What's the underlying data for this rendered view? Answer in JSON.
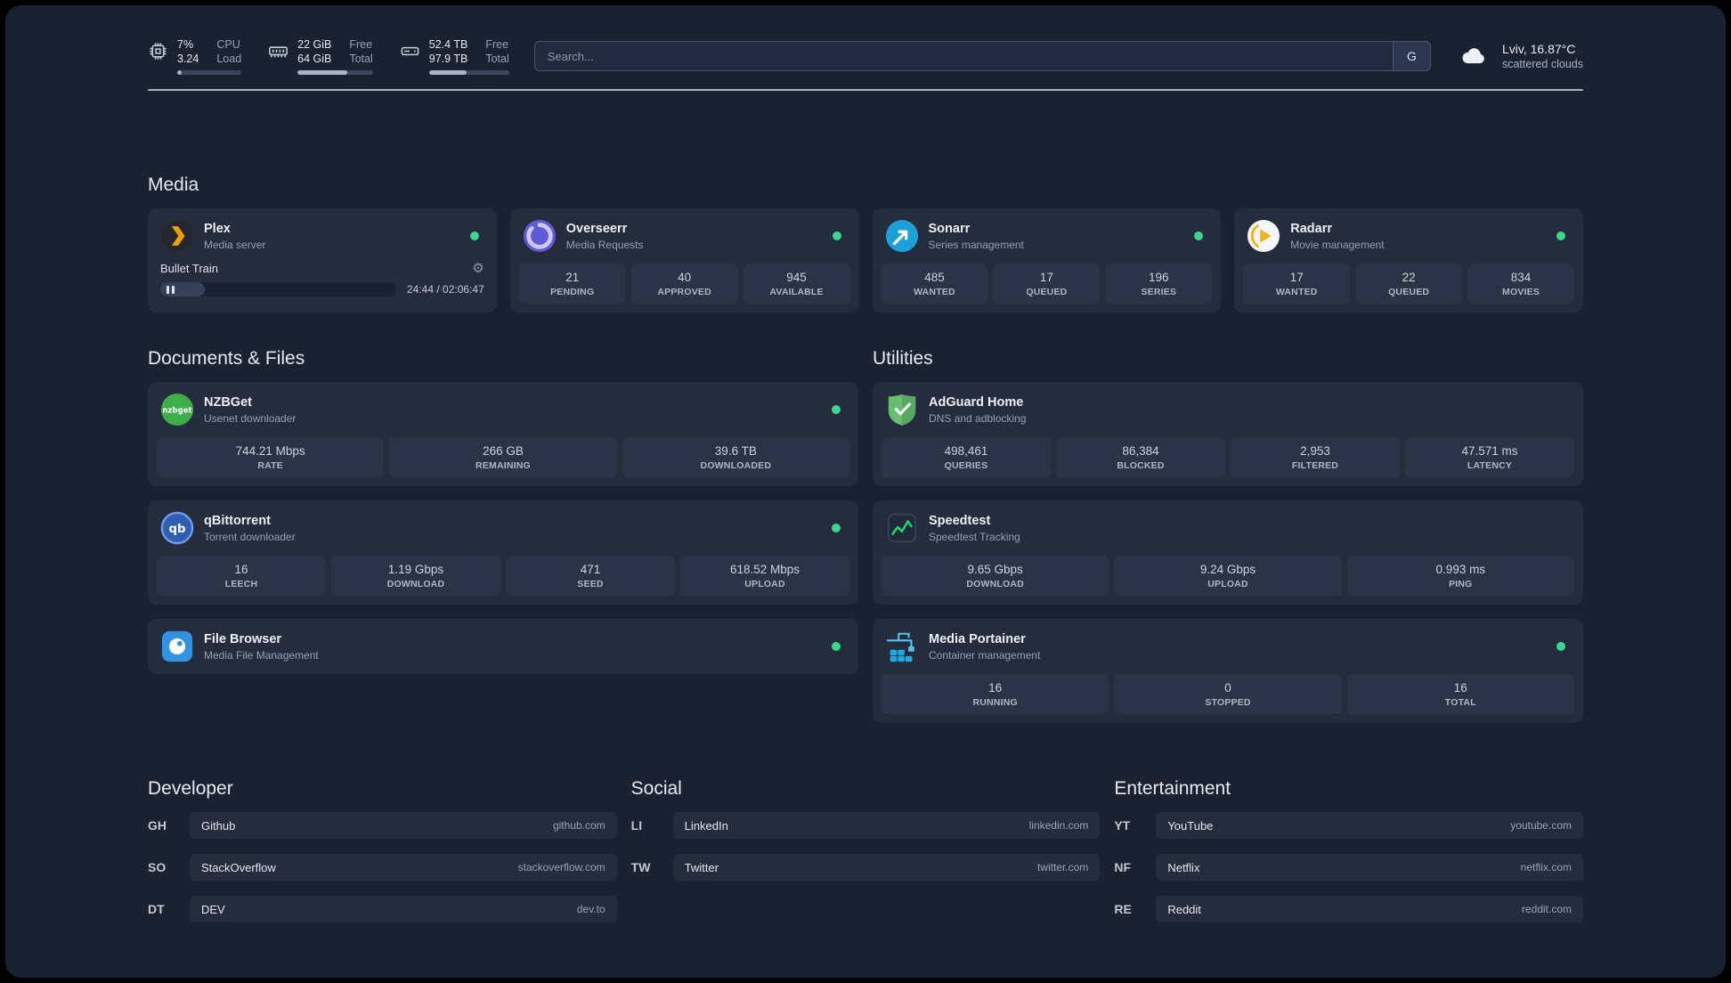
{
  "topbar": {
    "resources": [
      {
        "icon": "cpu-icon",
        "values": [
          "7%",
          "3.24"
        ],
        "labels": [
          "CPU",
          "Load"
        ],
        "progress": 7
      },
      {
        "icon": "memory-icon",
        "values": [
          "22 GiB",
          "64 GiB"
        ],
        "labels": [
          "Free",
          "Total"
        ],
        "progress": 66
      },
      {
        "icon": "disk-icon",
        "values": [
          "52.4 TB",
          "97.9 TB"
        ],
        "labels": [
          "Free",
          "Total"
        ],
        "progress": 47
      }
    ],
    "search": {
      "placeholder": "Search...",
      "provider": "G"
    },
    "weather": {
      "icon": "cloud-icon",
      "location": "Lviv, 16.87°C",
      "condition": "scattered clouds"
    }
  },
  "media": {
    "title": "Media",
    "plex": {
      "title": "Plex",
      "subtitle": "Media server",
      "online": true,
      "now_playing": "Bullet Train",
      "time": "24:44 / 02:06:47",
      "progress": 19
    },
    "cards": [
      {
        "title": "Overseerr",
        "subtitle": "Media Requests",
        "online": true,
        "stats": [
          {
            "value": "21",
            "label": "PENDING"
          },
          {
            "value": "40",
            "label": "APPROVED"
          },
          {
            "value": "945",
            "label": "AVAILABLE"
          }
        ]
      },
      {
        "title": "Sonarr",
        "subtitle": "Series management",
        "online": true,
        "stats": [
          {
            "value": "485",
            "label": "WANTED"
          },
          {
            "value": "17",
            "label": "QUEUED"
          },
          {
            "value": "196",
            "label": "SERIES"
          }
        ]
      },
      {
        "title": "Radarr",
        "subtitle": "Movie management",
        "online": true,
        "stats": [
          {
            "value": "17",
            "label": "WANTED"
          },
          {
            "value": "22",
            "label": "QUEUED"
          },
          {
            "value": "834",
            "label": "MOVIES"
          }
        ]
      }
    ]
  },
  "documents": {
    "title": "Documents & Files",
    "cards": [
      {
        "title": "NZBGet",
        "subtitle": "Usenet downloader",
        "online": true,
        "stats": [
          {
            "value": "744.21 Mbps",
            "label": "RATE"
          },
          {
            "value": "266 GB",
            "label": "REMAINING"
          },
          {
            "value": "39.6 TB",
            "label": "DOWNLOADED"
          }
        ]
      },
      {
        "title": "qBittorrent",
        "subtitle": "Torrent downloader",
        "online": true,
        "stats": [
          {
            "value": "16",
            "label": "LEECH"
          },
          {
            "value": "1.19 Gbps",
            "label": "DOWNLOAD"
          },
          {
            "value": "471",
            "label": "SEED"
          },
          {
            "value": "618.52 Mbps",
            "label": "UPLOAD"
          }
        ]
      },
      {
        "title": "File Browser",
        "subtitle": "Media File Management",
        "online": true,
        "stats": []
      }
    ]
  },
  "utilities": {
    "title": "Utilities",
    "cards": [
      {
        "title": "AdGuard Home",
        "subtitle": "DNS and adblocking",
        "online": false,
        "stats": [
          {
            "value": "498,461",
            "label": "QUERIES"
          },
          {
            "value": "86,384",
            "label": "BLOCKED"
          },
          {
            "value": "2,953",
            "label": "FILTERED"
          },
          {
            "value": "47.571 ms",
            "label": "LATENCY"
          }
        ]
      },
      {
        "title": "Speedtest",
        "subtitle": "Speedtest Tracking",
        "online": false,
        "stats": [
          {
            "value": "9.65 Gbps",
            "label": "DOWNLOAD"
          },
          {
            "value": "9.24 Gbps",
            "label": "UPLOAD"
          },
          {
            "value": "0.993 ms",
            "label": "PING"
          }
        ]
      },
      {
        "title": "Media Portainer",
        "subtitle": "Container management",
        "online": true,
        "stats": [
          {
            "value": "16",
            "label": "RUNNING"
          },
          {
            "value": "0",
            "label": "STOPPED"
          },
          {
            "value": "16",
            "label": "TOTAL"
          }
        ]
      }
    ]
  },
  "bookmarks": [
    {
      "title": "Developer",
      "items": [
        {
          "abbr": "GH",
          "name": "Github",
          "domain": "github.com"
        },
        {
          "abbr": "SO",
          "name": "StackOverflow",
          "domain": "stackoverflow.com"
        },
        {
          "abbr": "DT",
          "name": "DEV",
          "domain": "dev.to"
        }
      ]
    },
    {
      "title": "Social",
      "items": [
        {
          "abbr": "LI",
          "name": "LinkedIn",
          "domain": "linkedin.com"
        },
        {
          "abbr": "TW",
          "name": "Twitter",
          "domain": "twitter.com"
        }
      ]
    },
    {
      "title": "Entertainment",
      "items": [
        {
          "abbr": "YT",
          "name": "YouTube",
          "domain": "youtube.com"
        },
        {
          "abbr": "NF",
          "name": "Netflix",
          "domain": "netflix.com"
        },
        {
          "abbr": "RE",
          "name": "Reddit",
          "domain": "reddit.com"
        }
      ]
    }
  ],
  "icons": {
    "cpu": "cpu-chip",
    "memory": "memory-stick",
    "disk": "hard-drive",
    "weather": "cloud",
    "gear": "⚙",
    "pause": "❚❚"
  },
  "colors": {
    "background": "#1a2232",
    "card": "#242c3e",
    "tile": "#2b3447",
    "status_green": "#3fd68f",
    "plex": "#e8a00d",
    "overseerr": "#5d5bd5",
    "sonarr": "#1d9fd8",
    "radarr": "#efb320",
    "nzbget": "#3fae4a",
    "qbittorrent": "#2f5fb3",
    "filebrowser": "#3492e0",
    "adguard": "#68bd71",
    "speedtest_line": "#2dd36f",
    "portainer": "#1fa9e4"
  }
}
